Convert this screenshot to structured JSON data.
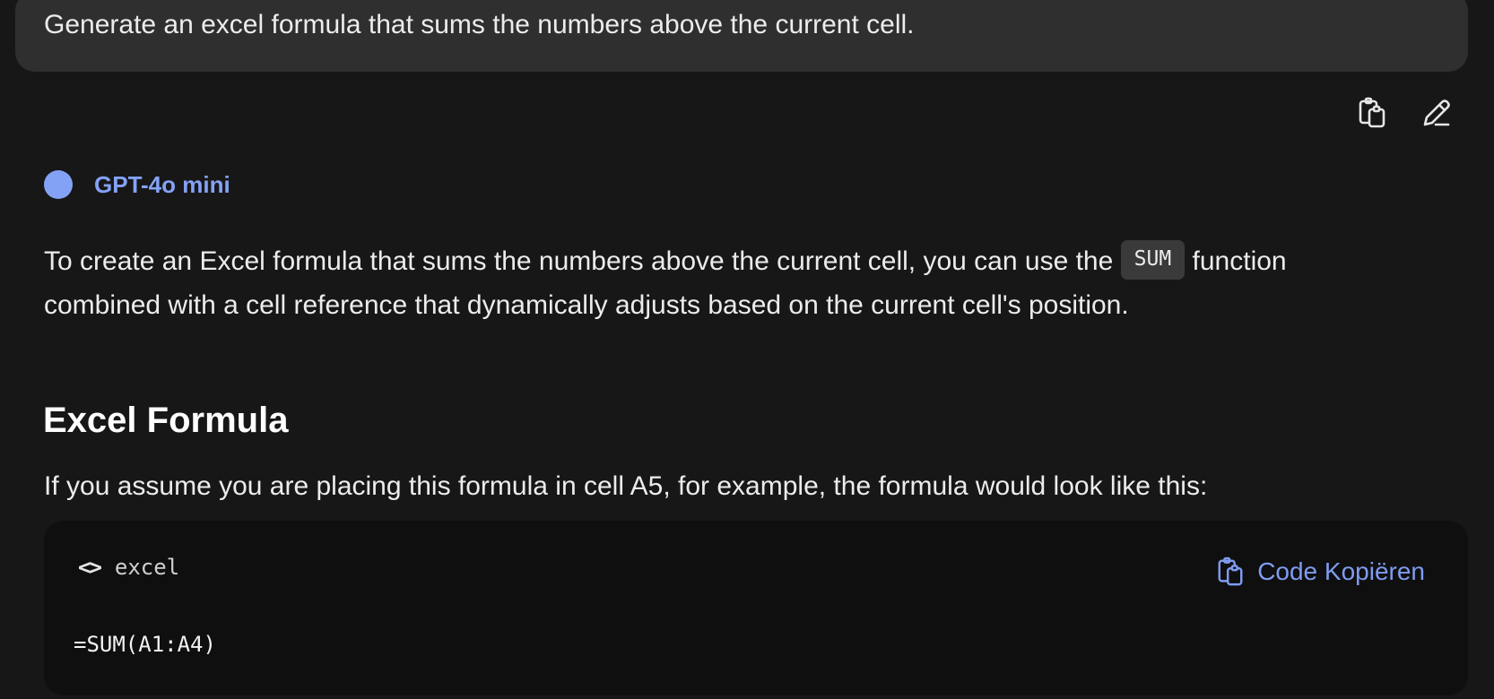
{
  "user_message": {
    "text": "Generate an excel formula that sums the numbers above the current cell."
  },
  "message_actions": {
    "copy_icon": "copy-icon",
    "edit_icon": "pencil-icon"
  },
  "assistant": {
    "model_name": "GPT-4o mini",
    "accent_color": "#84a2f5",
    "intro_line1_before": "To create an Excel formula that sums the numbers above the current cell, you can use the",
    "intro_code": "SUM",
    "intro_line1_after": "function",
    "intro_line2": "combined with a cell reference that dynamically adjusts based on the current cell's position.",
    "heading": "Excel Formula",
    "example_text": "If you assume you are placing this formula in cell A5, for example, the formula would look like this:"
  },
  "code_block": {
    "language": "excel",
    "lang_icon": "code-brackets-icon",
    "copy_label": "Code Kopiëren",
    "code": "=SUM(A1:A4)"
  }
}
